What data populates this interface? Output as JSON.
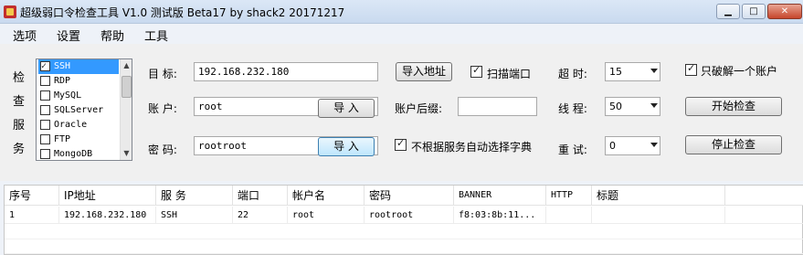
{
  "window": {
    "title": "超级弱口令检查工具 V1.0 测试版 Beta17 by shack2 20171217",
    "controls": {
      "minimize": "▁",
      "maximize": "□",
      "close": "✕"
    }
  },
  "menu": [
    "选项",
    "设置",
    "帮助",
    "工具"
  ],
  "services": {
    "group_label": [
      "检",
      "查",
      "服",
      "务"
    ],
    "items": [
      {
        "name": "SSH",
        "checked": true,
        "selected": true
      },
      {
        "name": "RDP",
        "checked": false,
        "selected": false
      },
      {
        "name": "MySQL",
        "checked": false,
        "selected": false
      },
      {
        "name": "SQLServer",
        "checked": false,
        "selected": false
      },
      {
        "name": "Oracle",
        "checked": false,
        "selected": false
      },
      {
        "name": "FTP",
        "checked": false,
        "selected": false
      },
      {
        "name": "MongoDB",
        "checked": false,
        "selected": false
      }
    ],
    "scroll_up": "▲",
    "scroll_down": "▼"
  },
  "form": {
    "target_label": "目  标:",
    "target_value": "192.168.232.180",
    "import_address_button": "导入地址",
    "scan_port_label": "扫描端口",
    "scan_port_checked": true,
    "timeout_label": "超  时:",
    "timeout_value": "15",
    "only_one_label": "只破解一个账户",
    "only_one_checked": true,
    "account_label": "账  户:",
    "account_value": "root",
    "import_account_button": "导 入",
    "suffix_label": "账户后缀:",
    "suffix_value": "",
    "threads_label": "线  程:",
    "threads_value": "50",
    "start_button": "开始检查",
    "password_label": "密  码:",
    "password_value": "rootroot",
    "import_password_button": "导 入",
    "auto_dict_label": "不根据服务自动选择字典",
    "auto_dict_checked": true,
    "retry_label": "重  试:",
    "retry_value": "0",
    "stop_button": "停止检查"
  },
  "results": {
    "columns": [
      "序号",
      "IP地址",
      "服 务",
      "端口",
      "帐户名",
      "密码",
      "BANNER",
      "HTTP",
      "标题"
    ],
    "rows": [
      [
        "1",
        "192.168.232.180",
        "SSH",
        "22",
        "root",
        "rootroot",
        "f8:03:8b:11...",
        "",
        ""
      ]
    ]
  }
}
